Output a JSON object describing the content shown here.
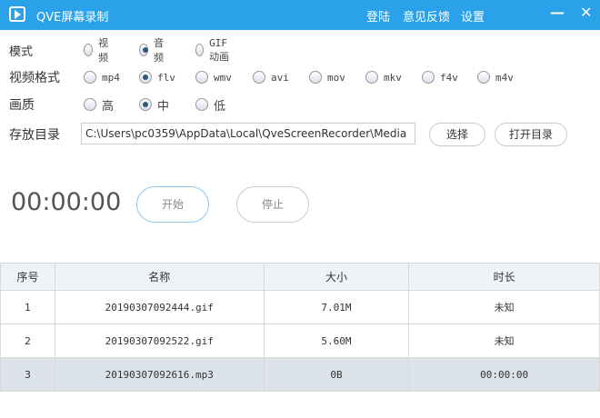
{
  "window": {
    "title": "QVE屏幕录制",
    "menu": [
      "登陆",
      "意见反馈",
      "设置"
    ],
    "minimize": "—",
    "close": "✕"
  },
  "mode": {
    "label": "模式",
    "options": [
      "视频",
      "音频",
      "GIF动画"
    ],
    "selected": 1
  },
  "format": {
    "label": "视频格式",
    "options": [
      "mp4",
      "flv",
      "wmv",
      "avi",
      "mov",
      "mkv",
      "f4v",
      "m4v"
    ],
    "selected": 1
  },
  "quality": {
    "label": "画质",
    "options": [
      "高",
      "中",
      "低"
    ],
    "selected": 1
  },
  "storage": {
    "label": "存放目录",
    "path": "C:\\Users\\pc0359\\AppData\\Local\\QveScreenRecorder\\Media",
    "choose": "选择",
    "open": "打开目录"
  },
  "timer": "00:00:00",
  "start": "开始",
  "stop": "停止",
  "table": {
    "headers": [
      "序号",
      "名称",
      "大小",
      "时长"
    ],
    "rows": [
      [
        "1",
        "20190307092444.gif",
        "7.01M",
        "未知"
      ],
      [
        "2",
        "20190307092522.gif",
        "5.60M",
        "未知"
      ],
      [
        "3",
        "20190307092616.mp3",
        "0B",
        "00:00:00"
      ]
    ]
  }
}
